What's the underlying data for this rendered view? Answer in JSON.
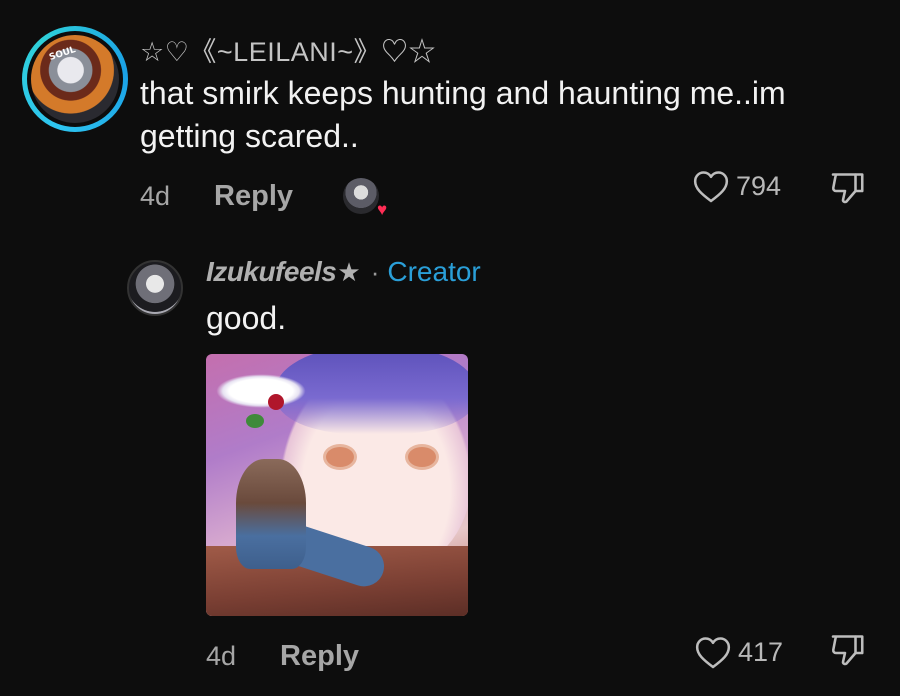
{
  "comment": {
    "username": "☆♡《~LEILANI~》♡☆",
    "text": "that smirk keeps hunting and haunting me..im getting scared..",
    "time": "4d",
    "reply_label": "Reply",
    "like_count": "794"
  },
  "reply": {
    "username": "Izukufeels",
    "username_suffix": "★",
    "separator": "·",
    "creator_badge": "Creator",
    "text": "good.",
    "time": "4d",
    "reply_label": "Reply",
    "like_count": "417"
  },
  "colors": {
    "background": "#0d0d0d",
    "creator_blue": "#2a9fd8",
    "avatar_ring": "#2ec5f0",
    "like_heart_red": "#ff2d55"
  },
  "icons": {
    "like": "heart-outline-icon",
    "dislike": "thumbs-down-icon",
    "creator_liked": "heart-filled-icon"
  }
}
